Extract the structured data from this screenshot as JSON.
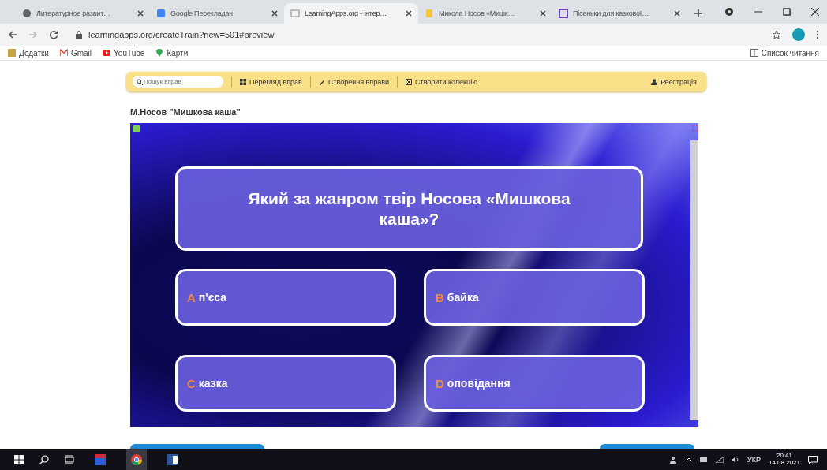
{
  "browser": {
    "tabs": [
      {
        "title": "Литературное развит…",
        "selected": false
      },
      {
        "title": "Google Перекладач",
        "selected": false
      },
      {
        "title": "LearningApps.org - інтер…",
        "selected": true
      },
      {
        "title": "Микола Носов «Мишк…",
        "selected": false
      },
      {
        "title": "Пісеньки для казкової…",
        "selected": false
      }
    ],
    "address": "learningapps.org/createTrain?new=501#preview",
    "bookmarks": [
      "Додатки",
      "Gmail",
      "YouTube",
      "Карти"
    ],
    "reading_list": "Список читання"
  },
  "site_toolbar": {
    "search": {
      "placeholder": "Пошук вправ"
    },
    "links": [
      "Перегляд вправ",
      "Створення вправи",
      "Створити колекцію"
    ],
    "register": "Реєстрація"
  },
  "exercise": {
    "title": "М.Носов \"Мишкова каша\"",
    "question": "Який за жанром твір Носова «Мишкова каша»?",
    "answers": [
      {
        "letter": "A",
        "text": "п'єса"
      },
      {
        "letter": "B",
        "text": "байка"
      },
      {
        "letter": "C",
        "text": "казка"
      },
      {
        "letter": "D",
        "text": "оповідання"
      }
    ]
  },
  "taskbar": {
    "language": "УКР",
    "time": "20:41",
    "date": "14.08.2021"
  }
}
